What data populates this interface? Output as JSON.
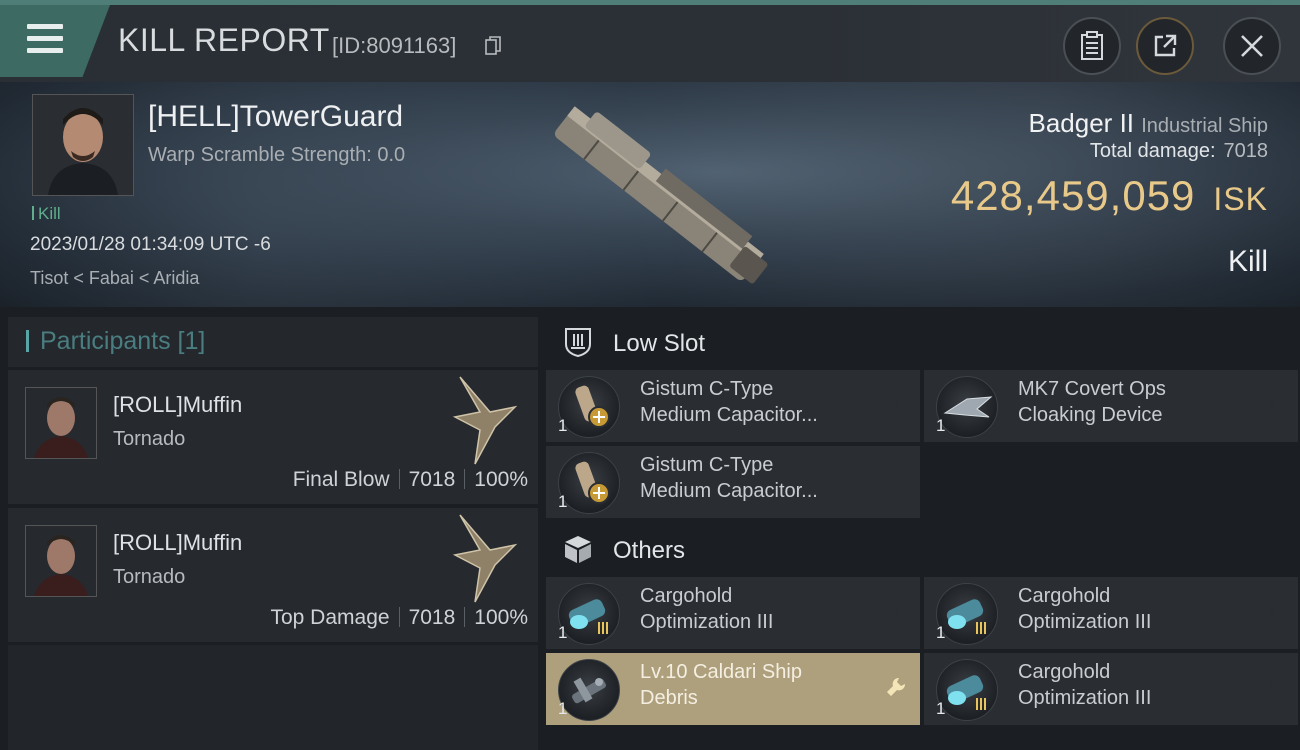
{
  "header": {
    "title": "KILL REPORT",
    "report_id": "[ID:8091163]"
  },
  "victim": {
    "name": "[HELL]TowerGuard",
    "warp_scramble": "Warp Scramble Strength: 0.0",
    "kill_count": "Kill",
    "timestamp": "2023/01/28 01:34:09 UTC -6",
    "location": "Tisot < Fabai < Aridia",
    "ship_name": "Badger II",
    "ship_class": "Industrial Ship",
    "total_damage_label": "Total damage:",
    "total_damage_value": "7018",
    "isk_value": "428,459,059",
    "isk_unit": "ISK",
    "result": "Kill"
  },
  "participants": {
    "header": "Participants [1]",
    "items": [
      {
        "name": "[ROLL]Muffin",
        "ship": "Tornado",
        "role": "Final Blow",
        "damage": "7018",
        "percent": "100%"
      },
      {
        "name": "[ROLL]Muffin",
        "ship": "Tornado",
        "role": "Top Damage",
        "damage": "7018",
        "percent": "100%"
      }
    ]
  },
  "sections": {
    "low_slot": "Low Slot",
    "others": "Others"
  },
  "low_slot_items": [
    {
      "qty": "1",
      "line1": "Gistum C-Type",
      "line2": "Medium Capacitor..."
    },
    {
      "qty": "1",
      "line1": "MK7 Covert Ops",
      "line2": "Cloaking Device"
    },
    {
      "qty": "1",
      "line1": "Gistum C-Type",
      "line2": "Medium Capacitor..."
    }
  ],
  "other_items": [
    {
      "qty": "1",
      "line1": "Cargohold",
      "line2": "Optimization III"
    },
    {
      "qty": "1",
      "line1": "Cargohold",
      "line2": "Optimization III"
    },
    {
      "qty": "1",
      "line1": "Lv.10 Caldari Ship",
      "line2": "Debris"
    },
    {
      "qty": "1",
      "line1": "Cargohold",
      "line2": "Optimization III"
    }
  ],
  "colors": {
    "accent_teal": "#3d6a62",
    "isk_gold": "#e8c98a",
    "highlight_item": "#aea07c",
    "kill_green": "#5fae8c"
  }
}
